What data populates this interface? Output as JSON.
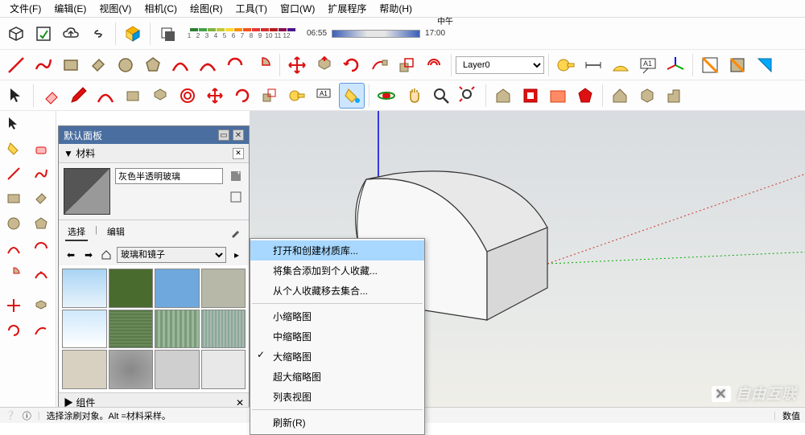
{
  "menu": [
    "文件(F)",
    "编辑(E)",
    "视图(V)",
    "相机(C)",
    "绘图(R)",
    "工具(T)",
    "窗口(W)",
    "扩展程序",
    "帮助(H)"
  ],
  "colorscale_labels": [
    "1",
    "2",
    "3",
    "4",
    "5",
    "6",
    "7",
    "8",
    "9",
    "10",
    "11",
    "12"
  ],
  "colorscale_colors": [
    "#2e7d32",
    "#43a047",
    "#7cb342",
    "#c0ca33",
    "#fdd835",
    "#fb8c00",
    "#f4511e",
    "#e53935",
    "#d32f2f",
    "#b71c1c",
    "#880e4f",
    "#4a148c"
  ],
  "time": {
    "start": "06:55",
    "mid": "中午",
    "end": "17:00"
  },
  "layer": "Layer0",
  "panel": {
    "title": "默认面板",
    "section": "材料",
    "material_name": "灰色半透明玻璃",
    "tab_select": "选择",
    "tab_edit": "编辑",
    "library": "玻璃和镜子",
    "footer": "组件"
  },
  "thumbs": [
    "linear-gradient(#a9d4f5,#e8f3fb)",
    "#4a6b2e",
    "#6fa8dc",
    "#b8b8a8",
    "linear-gradient(#cfe8fb,#fff)",
    "repeating-linear-gradient(0deg,#5a7a4a 0 2px,#6a8a5a 2px 4px)",
    "repeating-linear-gradient(90deg,#7a9a7a 0 3px,#9ab89a 3px 6px)",
    "repeating-linear-gradient(90deg,#8aa89a 0 2px,#aabab0 2px 4px)",
    "#d8d0c0",
    "radial-gradient(#888,#aaa)",
    "#cfcfcf",
    "#e8e8e8"
  ],
  "context_menu": {
    "items": [
      {
        "label": "打开和创建材质库...",
        "selected": true
      },
      {
        "label": "将集合添加到个人收藏..."
      },
      {
        "label": "从个人收藏移去集合..."
      },
      {
        "divider": true
      },
      {
        "label": "小缩略图"
      },
      {
        "label": "中缩略图"
      },
      {
        "label": "大缩略图",
        "checked": true
      },
      {
        "label": "超大缩略图"
      },
      {
        "label": "列表视图"
      },
      {
        "divider": true
      },
      {
        "label": "刷新(R)"
      }
    ]
  },
  "status": {
    "hint": "选择涂刷对象。Alt =材料采样。",
    "label": "数值"
  },
  "watermark": "自由互联"
}
